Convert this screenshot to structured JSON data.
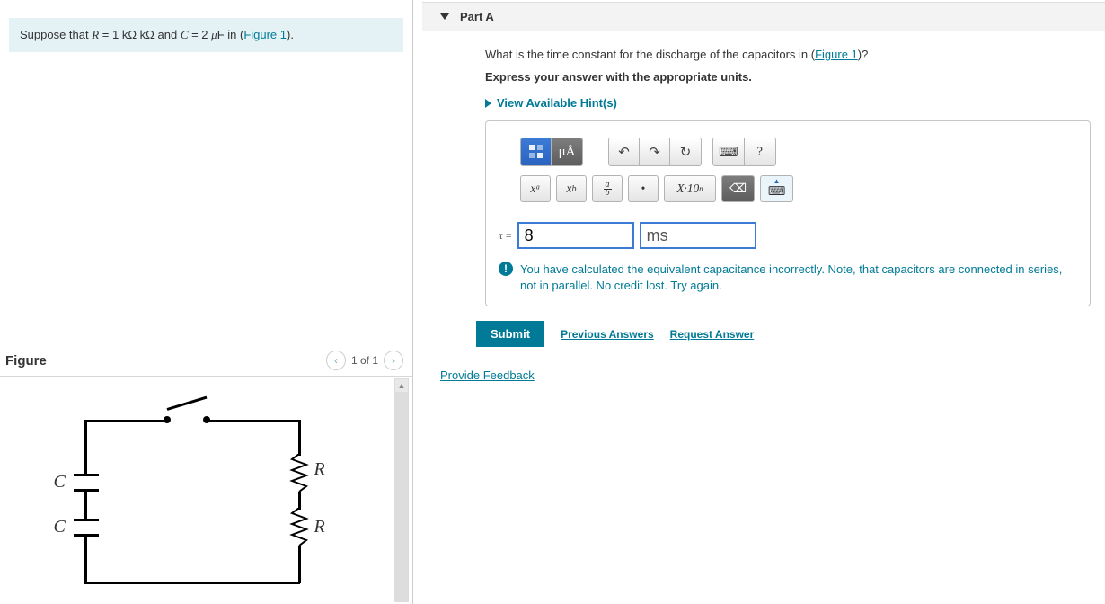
{
  "left": {
    "suppose_prefix": "Suppose that ",
    "suppose_r": "R",
    "suppose_r_eq": " = 1 kΩ kΩ and ",
    "suppose_c": "C",
    "suppose_c_eq": " = 2 ",
    "suppose_mu": "μ",
    "suppose_f": "F in (",
    "fig_link": "Figure 1",
    "suppose_end": ").",
    "figure_title": "Figure",
    "nav_text": "1 of 1",
    "labels": {
      "R1": "R",
      "R2": "R",
      "C1": "C",
      "C2": "C"
    }
  },
  "right": {
    "part_label": "Part A",
    "question_pre": "What is the time constant for the discharge of the capacitors in (",
    "question_link": "Figure 1",
    "question_post": ")?",
    "express": "Express your answer with the appropriate units.",
    "hints": "View Available Hint(s)",
    "toolbar": {
      "units": "μÅ",
      "undo": "↶",
      "redo": "↷",
      "reset": "↻",
      "keyboard": "⌨",
      "help": "?",
      "xsup": "xᵃ",
      "xsub": "x",
      "xsub_sub": "b",
      "frac_a": "a",
      "frac_b": "b",
      "dot": "•",
      "sci": "X·10",
      "sci_n": "n",
      "del": "⌫",
      "kbd2": "⌨"
    },
    "answer": {
      "tau": "τ =",
      "value": "8",
      "units": "ms"
    },
    "feedback": "You have calculated the equivalent capacitance incorrectly. Note, that capacitors are connected in series, not in parallel. No credit lost. Try again.",
    "submit": "Submit",
    "prev": "Previous Answers",
    "request": "Request Answer",
    "provide": "Provide Feedback"
  }
}
